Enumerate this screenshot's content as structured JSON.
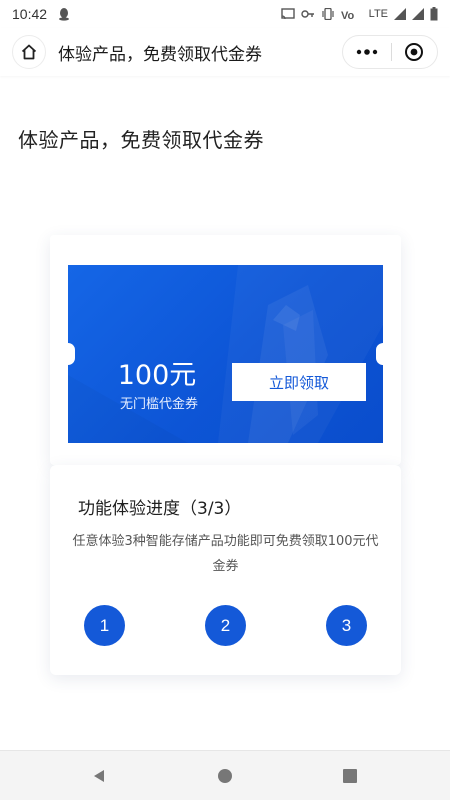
{
  "status_bar": {
    "time": "10:42",
    "network": "LTE"
  },
  "nav": {
    "title": "体验产品，免费领取代金券"
  },
  "page": {
    "heading": "体验产品，免费领取代金券"
  },
  "coupon": {
    "amount": "100元",
    "description": "无门槛代金券",
    "claim_label": "立即领取"
  },
  "progress": {
    "title": "功能体验进度（3/3）",
    "description": "任意体验3种智能存储产品功能即可免费领取100元代金券",
    "steps": [
      "1",
      "2",
      "3"
    ]
  },
  "colors": {
    "accent": "#1459d8",
    "coupon_bg": "#1566e6"
  },
  "icons": {
    "home": "home-icon",
    "more": "more-dots-icon",
    "close": "target-close-icon",
    "back": "triangle-back-icon",
    "sys_home": "circle-home-icon",
    "recent": "square-recent-icon"
  }
}
